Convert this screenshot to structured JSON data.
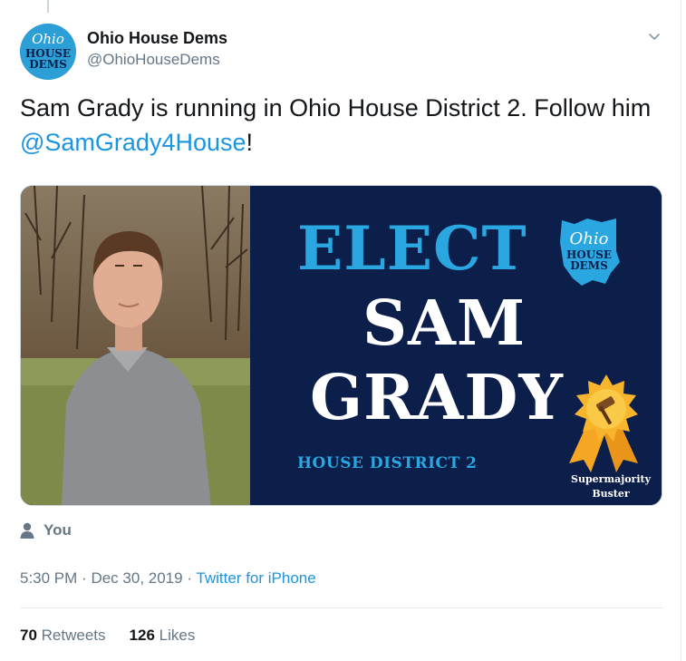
{
  "account": {
    "display_name": "Ohio House Dems",
    "handle": "@OhioHouseDems",
    "avatar_text": [
      "Ohio",
      "HOUSE",
      "DEMS"
    ]
  },
  "tweet": {
    "text_before": "Sam Grady is running in Ohio House District 2. Follow him ",
    "mention": "@SamGrady4House",
    "text_after": "!"
  },
  "media": {
    "headline_1": "ELECT",
    "headline_2": "SAM",
    "headline_3": "GRADY",
    "district": "HOUSE DISTRICT 2",
    "logo_text": [
      "Ohio",
      "HOUSE",
      "DEMS"
    ],
    "badge_line_1": "Supermajority",
    "badge_line_2": "Buster"
  },
  "tagged": {
    "label": "You"
  },
  "meta": {
    "time": "5:30 PM",
    "separator": "·",
    "date": "Dec 30, 2019",
    "client": "Twitter for iPhone"
  },
  "stats": {
    "retweets_count": "70",
    "retweets_label": "Retweets",
    "likes_count": "126",
    "likes_label": "Likes"
  },
  "colors": {
    "link": "#1b95e0",
    "poster_bg": "#0b1f4a",
    "poster_accent": "#2aa6e0",
    "badge_gold": "#f5a623"
  },
  "icons": {
    "caret": "chevron-down-icon",
    "person": "person-icon",
    "gavel": "gavel-icon"
  }
}
